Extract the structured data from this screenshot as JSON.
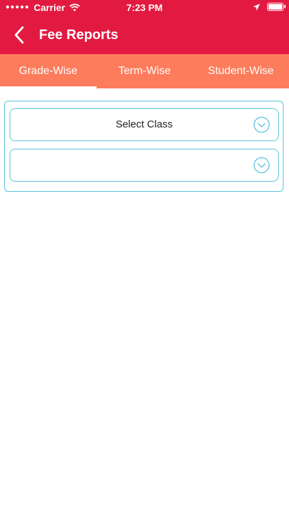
{
  "status_bar": {
    "carrier": "Carrier",
    "time": "7:23 PM",
    "signal_icon": "signal-dots-icon",
    "wifi_icon": "wifi-icon",
    "location_icon": "location-arrow-icon",
    "battery_icon": "battery-icon"
  },
  "nav": {
    "title": "Fee Reports",
    "back_icon": "chevron-left-icon"
  },
  "tabs": [
    {
      "label": "Grade-Wise",
      "active": true
    },
    {
      "label": "Term-Wise",
      "active": false
    },
    {
      "label": "Student-Wise",
      "active": false
    }
  ],
  "form": {
    "class_select": {
      "value": "Select Class"
    },
    "second_select": {
      "value": ""
    }
  },
  "colors": {
    "header": "#e21a41",
    "tab_bar": "#fd7c5c",
    "border": "#54c4dc"
  }
}
